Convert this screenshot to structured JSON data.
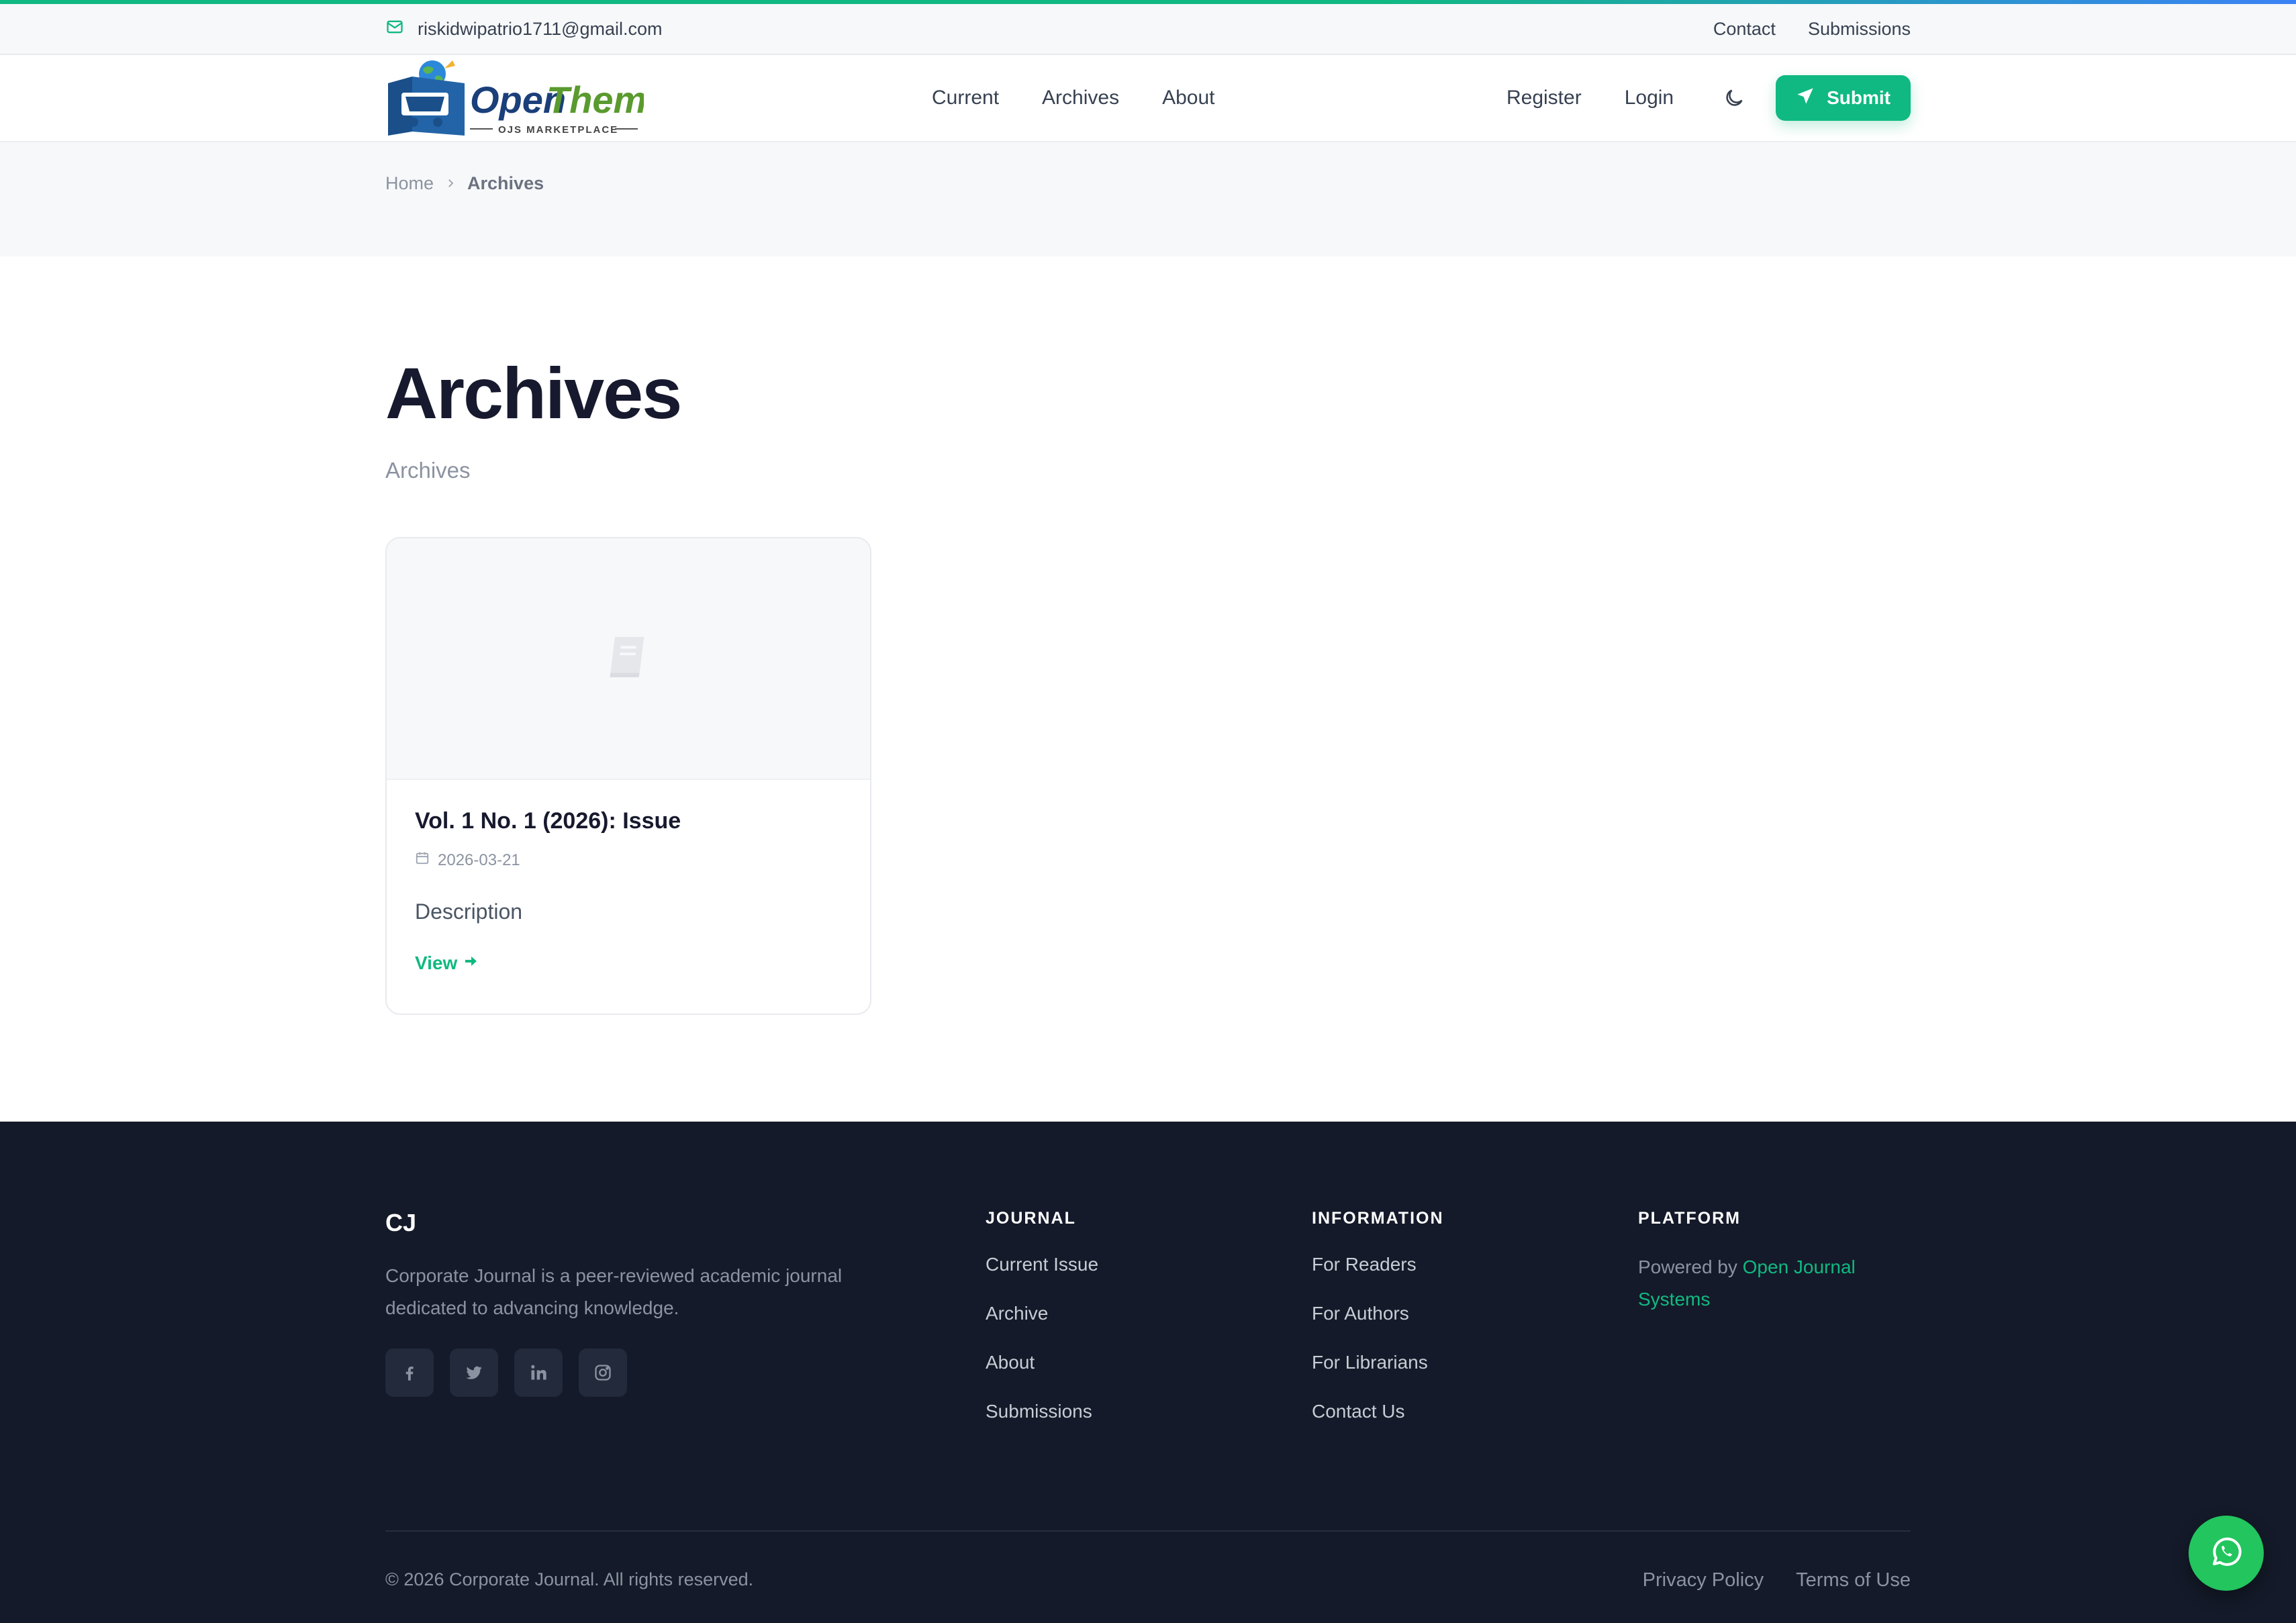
{
  "topbar": {
    "email": "riskidwipatrio1711@gmail.com",
    "links": [
      "Contact",
      "Submissions"
    ]
  },
  "header": {
    "logo": {
      "name": "OpenThemes",
      "tagline": "OJS MARKETPLACE"
    },
    "nav": [
      "Current",
      "Archives",
      "About"
    ],
    "register": "Register",
    "login": "Login",
    "submit": "Submit"
  },
  "breadcrumb": {
    "home": "Home",
    "current": "Archives"
  },
  "main": {
    "title": "Archives",
    "subtitle": "Archives",
    "issues": [
      {
        "title": "Vol. 1 No. 1 (2026): Issue",
        "date": "2026-03-21",
        "description": "Description",
        "action": "View"
      }
    ]
  },
  "footer": {
    "brand": "CJ",
    "description": "Corporate Journal is a peer-reviewed academic journal dedicated to advancing knowledge.",
    "columns": [
      {
        "heading": "JOURNAL",
        "links": [
          "Current Issue",
          "Archive",
          "About",
          "Submissions"
        ]
      },
      {
        "heading": "INFORMATION",
        "links": [
          "For Readers",
          "For Authors",
          "For Librarians",
          "Contact Us"
        ]
      }
    ],
    "platform": {
      "heading": "PLATFORM",
      "prefix": "Powered by ",
      "link": "Open Journal Systems"
    },
    "copyright": "© 2026 Corporate Journal. All rights reserved.",
    "legal": [
      "Privacy Policy",
      "Terms of Use"
    ]
  },
  "colors": {
    "accent": "#10b981",
    "footer_bg": "#141a29",
    "whatsapp": "#22c55e"
  }
}
